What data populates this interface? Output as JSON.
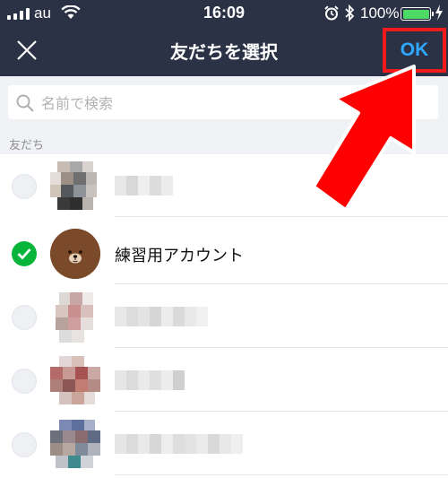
{
  "status_bar": {
    "carrier": "au",
    "time": "16:09",
    "battery_percent": "100%",
    "battery_level": 1.0,
    "icons": [
      "signal-icon",
      "wifi-icon",
      "alarm-icon",
      "bluetooth-icon",
      "battery-icon",
      "charging-icon"
    ]
  },
  "header": {
    "title": "友だちを選択",
    "ok_label": "OK",
    "close_icon": "close-icon"
  },
  "search": {
    "placeholder": "名前で検索",
    "value": ""
  },
  "section": {
    "label": "友だち"
  },
  "friends": [
    {
      "name": "",
      "selected": false,
      "blurred": true
    },
    {
      "name": "練習用アカウント",
      "selected": true,
      "blurred": false
    },
    {
      "name": "",
      "selected": false,
      "blurred": true
    },
    {
      "name": "",
      "selected": false,
      "blurred": true
    },
    {
      "name": "",
      "selected": false,
      "blurred": true
    }
  ],
  "colors": {
    "header_bg": "#2b3245",
    "ok_text": "#2ea7ff",
    "highlight_box": "#f21a1a",
    "check_green": "#07b53b",
    "annotation_arrow": "#ff0000"
  }
}
